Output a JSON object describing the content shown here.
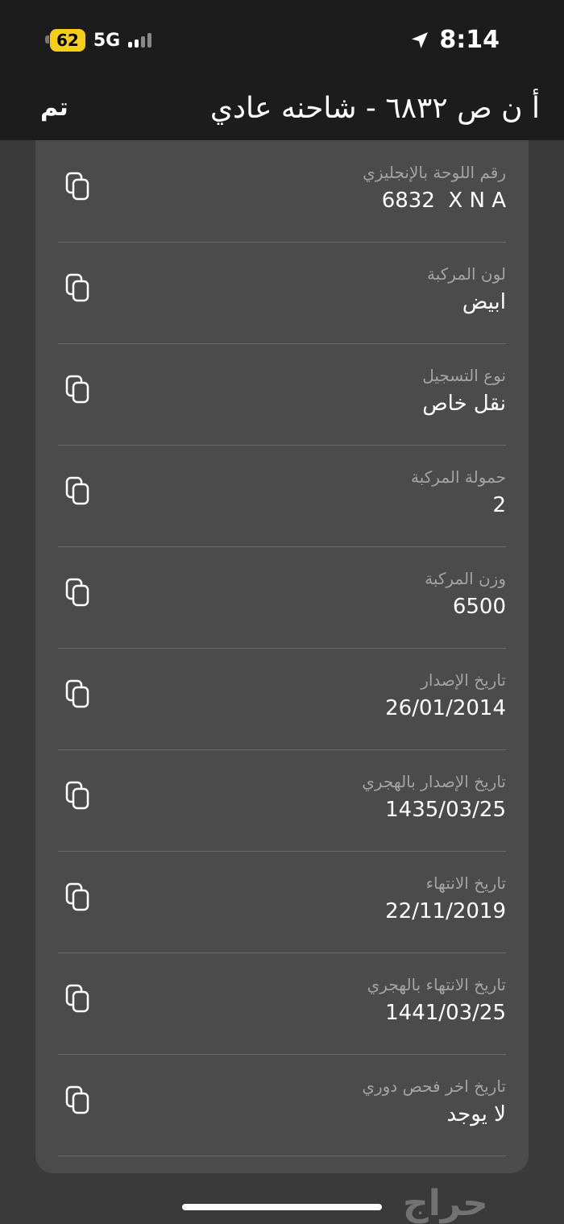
{
  "status_bar": {
    "battery": "62",
    "network": "5G",
    "time": "8:14"
  },
  "nav": {
    "done_label": "تم",
    "title": "أ ن ص ٦٨٣٢ - شاحنه عادي"
  },
  "rows": [
    {
      "label": "رقم اللوحة بالإنجليزي",
      "value": "6832  X N A"
    },
    {
      "label": "لون المركبة",
      "value": "ابيض"
    },
    {
      "label": "نوع التسجيل",
      "value": "نقل خاص"
    },
    {
      "label": "حمولة المركبة",
      "value": "2"
    },
    {
      "label": "وزن المركبة",
      "value": "6500"
    },
    {
      "label": "تاريخ الإصدار",
      "value": "26/01/2014"
    },
    {
      "label": "تاريخ الإصدار بالهجري",
      "value": "1435/03/25"
    },
    {
      "label": "تاريخ الانتهاء",
      "value": "22/11/2019"
    },
    {
      "label": "تاريخ الانتهاء بالهجري",
      "value": "1441/03/25"
    },
    {
      "label": "تاريخ اخر فحص دوري",
      "value": "لا يوجد"
    }
  ],
  "watermark": "حراج",
  "colors": {
    "background": "#3a3a3a",
    "bars": "#1c1c1c",
    "card": "#4b4b4b",
    "battery": "#f4cf1a"
  }
}
